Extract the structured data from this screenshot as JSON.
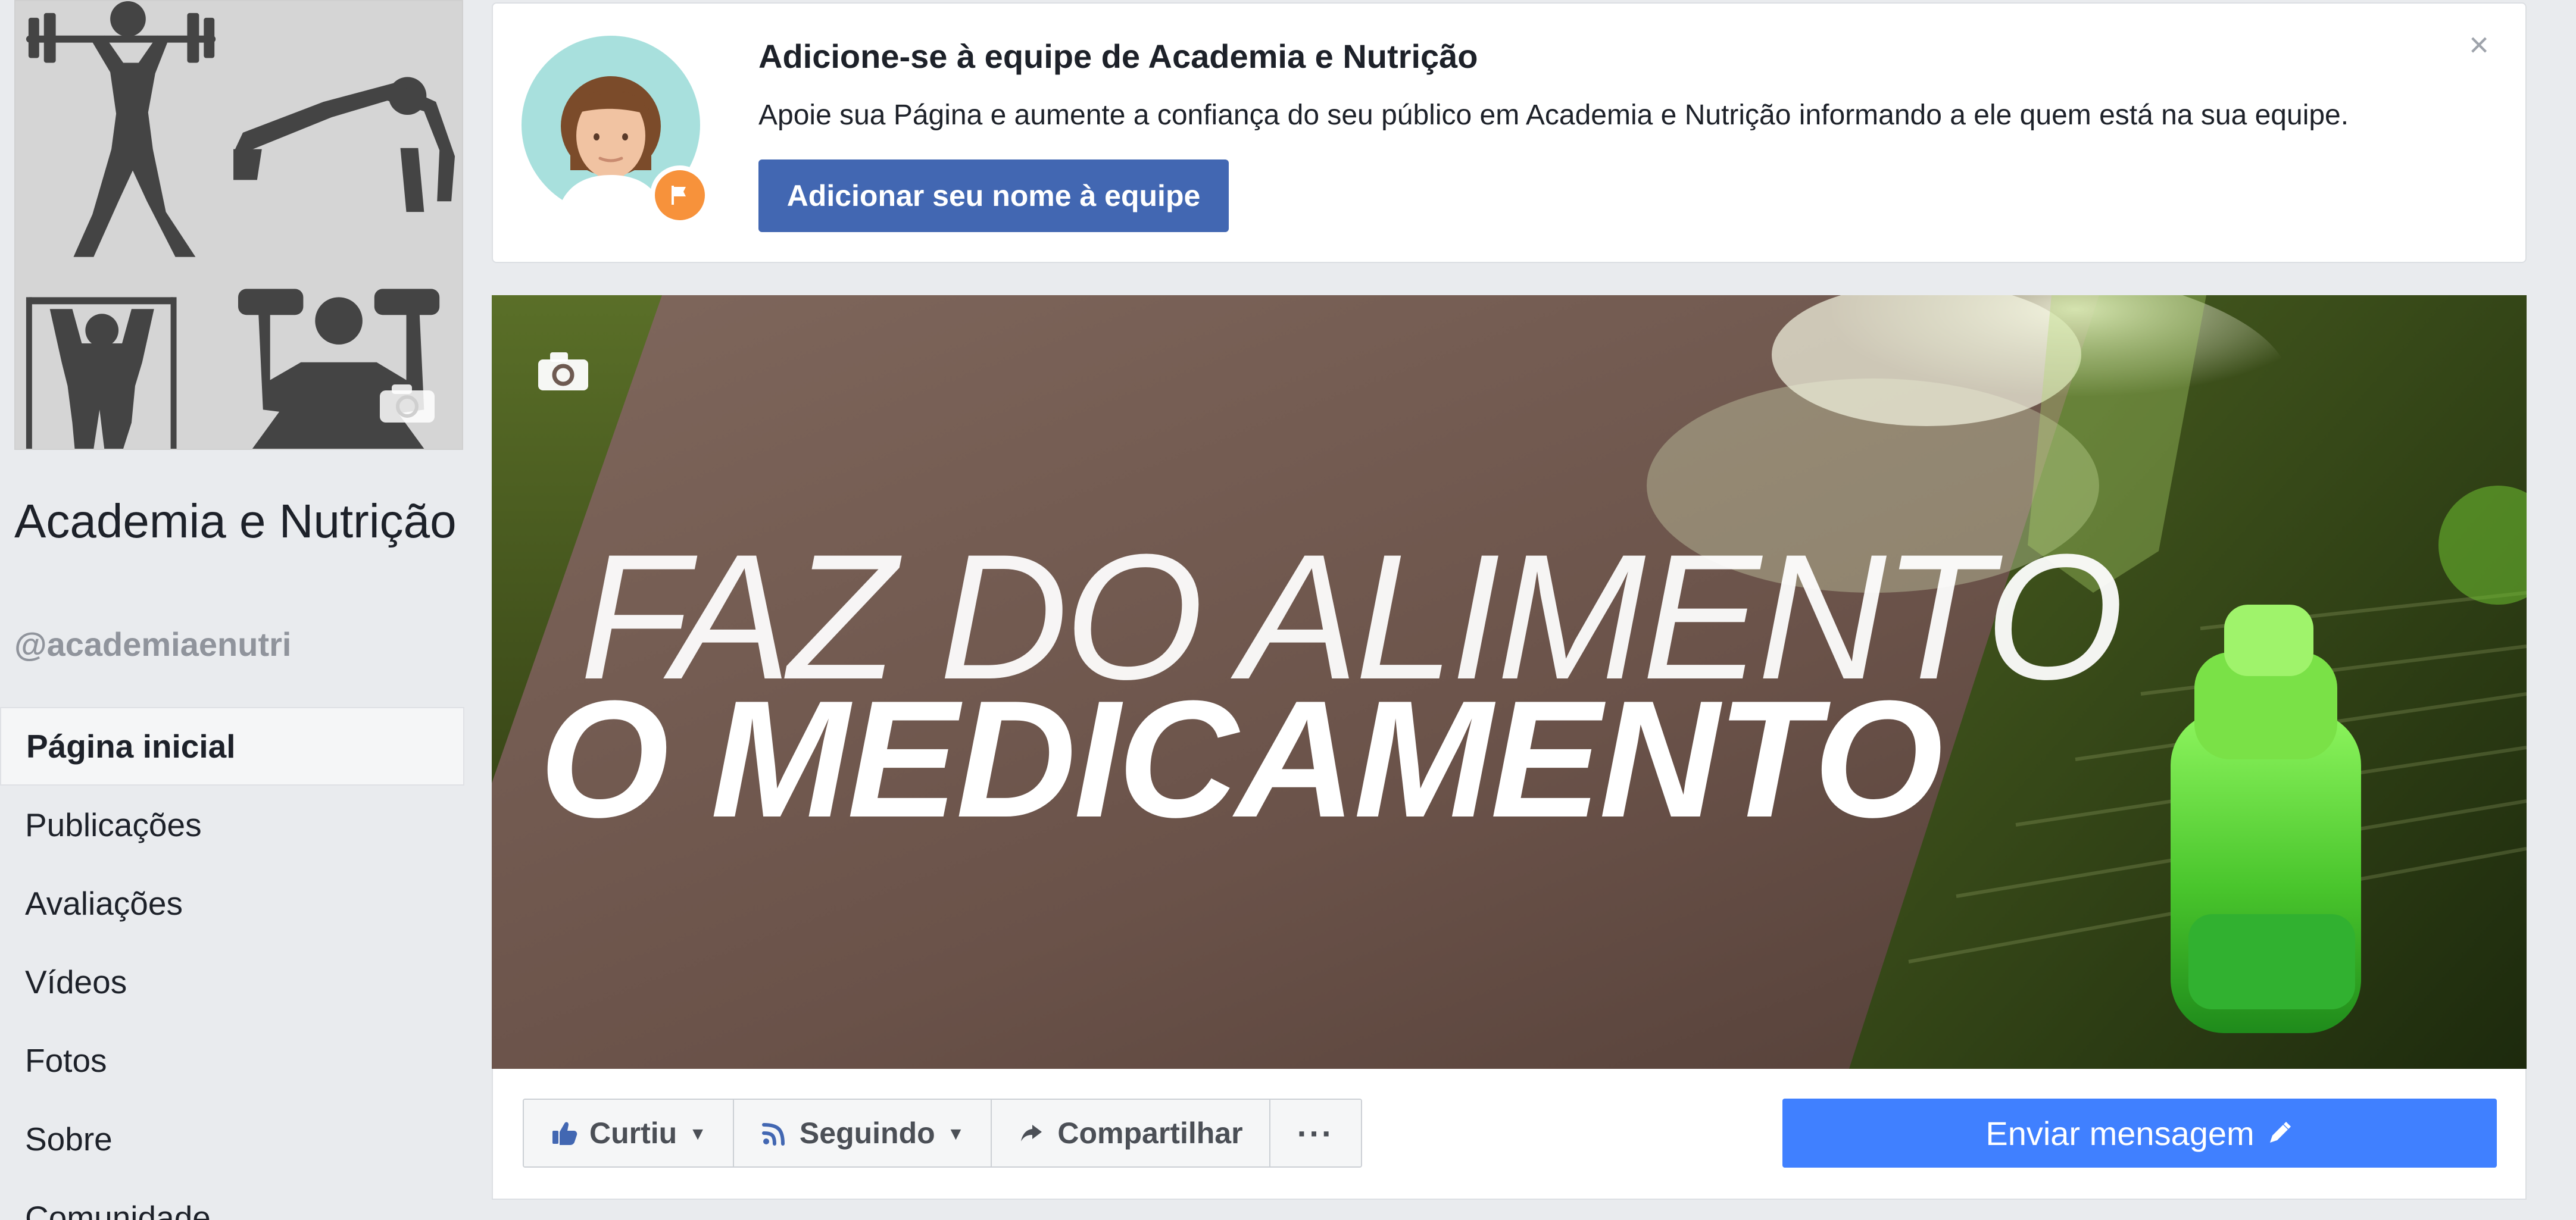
{
  "page": {
    "name": "Academia e Nutrição",
    "handle": "@academiaenutri"
  },
  "sidebar": {
    "items": [
      {
        "label": "Página inicial",
        "active": true
      },
      {
        "label": "Publicações"
      },
      {
        "label": "Avaliações"
      },
      {
        "label": "Vídeos"
      },
      {
        "label": "Fotos"
      },
      {
        "label": "Sobre"
      },
      {
        "label": "Comunidade"
      }
    ]
  },
  "team_card": {
    "title": "Adicione-se à equipe de Academia e Nutrição",
    "description": "Apoie sua Página e aumente a confiança do seu público em Academia e Nutrição informando a ele quem está na sua equipe.",
    "button_label": "Adicionar seu nome à equipe",
    "close_label": "×"
  },
  "cover": {
    "line1": "FAZ DO ALIMENTO",
    "line2": "O MEDICAMENTO"
  },
  "actions": {
    "liked_label": "Curtiu",
    "following_label": "Seguindo",
    "share_label": "Compartilhar",
    "more_label": "···",
    "message_label": "Enviar mensagem"
  },
  "icons": {
    "camera": "camera-icon",
    "like": "thumb-up-icon",
    "follow": "rss-icon",
    "share": "share-arrow-icon",
    "message": "pencil-icon",
    "close": "close-icon",
    "badge": "flag-icon"
  },
  "colors": {
    "facebook_blue": "#4267b2",
    "message_blue": "#4080ff",
    "background": "#e9ebee"
  }
}
